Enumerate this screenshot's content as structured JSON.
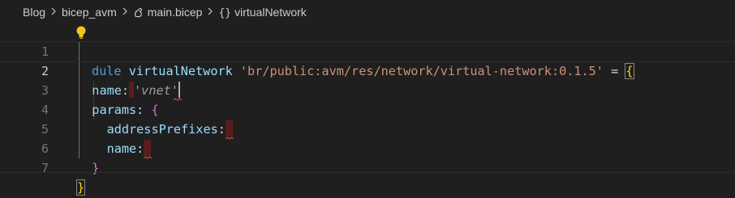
{
  "breadcrumb": {
    "items": [
      "Blog",
      "bicep_avm",
      "main.bicep",
      "virtualNetwork"
    ],
    "separator": "›"
  },
  "editor": {
    "line_numbers": [
      "1",
      "2",
      "3",
      "4",
      "5",
      "6",
      "7"
    ],
    "active_line": "2",
    "line1": {
      "keyword": "module",
      "keyword_visible": "dule",
      "symbol": "virtualNetwork",
      "path": "'br/public:avm/res/network/virtual-network:0.1.5'",
      "equals": "=",
      "open_brace": "{"
    },
    "line2": {
      "prop": "name",
      "colon": ":",
      "value": "'vnet'"
    },
    "line3": {
      "prop": "params",
      "colon": ":",
      "open_brace": "{"
    },
    "line4": {
      "prop": "addressPrefixes",
      "colon": ":"
    },
    "line5": {
      "prop": "name",
      "colon": ":"
    },
    "line6": {
      "close_brace": "}"
    },
    "line7": {
      "close_brace": "}"
    }
  },
  "colors": {
    "background": "#1f1f1f",
    "keyword": "#569cd6",
    "identifier": "#9cdcfe",
    "property": "#4ec9b0",
    "string": "#ce9178",
    "brace_level1": "#ffd700",
    "brace_level2": "#da70d6",
    "error": "#f14c4c"
  },
  "icons": {
    "bicep_file": "bicep-file-icon",
    "braces": "braces-icon",
    "lightbulb": "lightbulb-icon"
  }
}
